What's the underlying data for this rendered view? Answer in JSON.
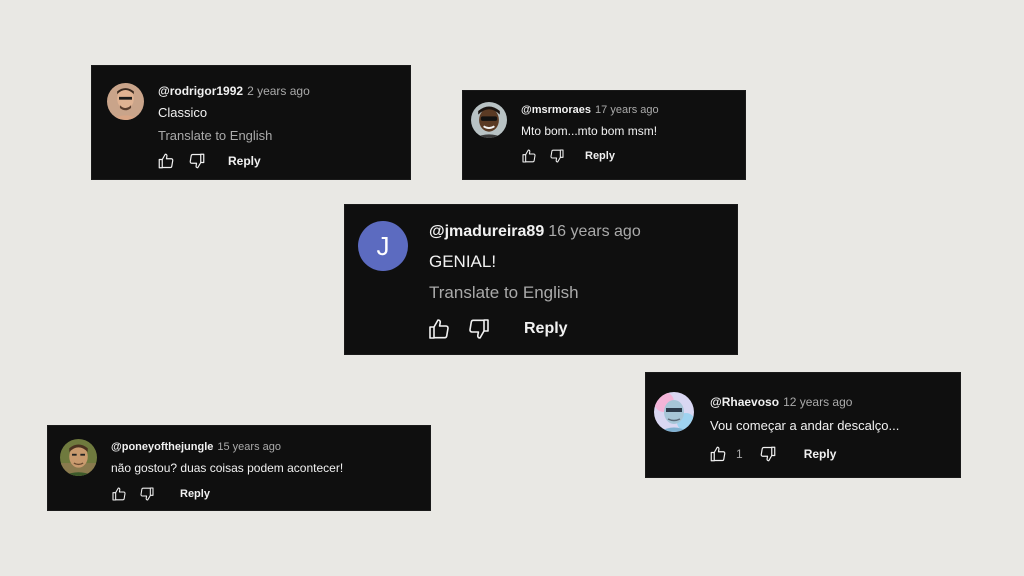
{
  "comments": [
    {
      "username": "@rodrigor1992",
      "time": "2 years ago",
      "text": "Classico",
      "translate": "Translate to English",
      "reply": "Reply",
      "avatar_icon": "user-photo-avatar"
    },
    {
      "username": "@msrmoraes",
      "time": "17 years ago",
      "text": "Mto bom...mto bom msm!",
      "reply": "Reply",
      "avatar_icon": "user-photo-avatar"
    },
    {
      "username": "@jmadureira89",
      "time": "16 years ago",
      "text": "GENIAL!",
      "translate": "Translate to English",
      "reply": "Reply",
      "avatar_letter": "J",
      "avatar_color": "#5c6bc0"
    },
    {
      "username": "@Rhaevoso",
      "time": "12 years ago",
      "text": "Vou começar a andar descalço...",
      "likes": "1",
      "reply": "Reply",
      "avatar_icon": "user-photo-avatar"
    },
    {
      "username": "@poneyofthejungle",
      "time": "15 years ago",
      "text": "não gostou? duas coisas podem acontecer!",
      "reply": "Reply",
      "avatar_icon": "user-photo-avatar"
    }
  ],
  "colors": {
    "background": "#e9e8e4",
    "card": "#0f0f0f",
    "text": "#f1f1f1",
    "muted": "#aaaaaa"
  }
}
